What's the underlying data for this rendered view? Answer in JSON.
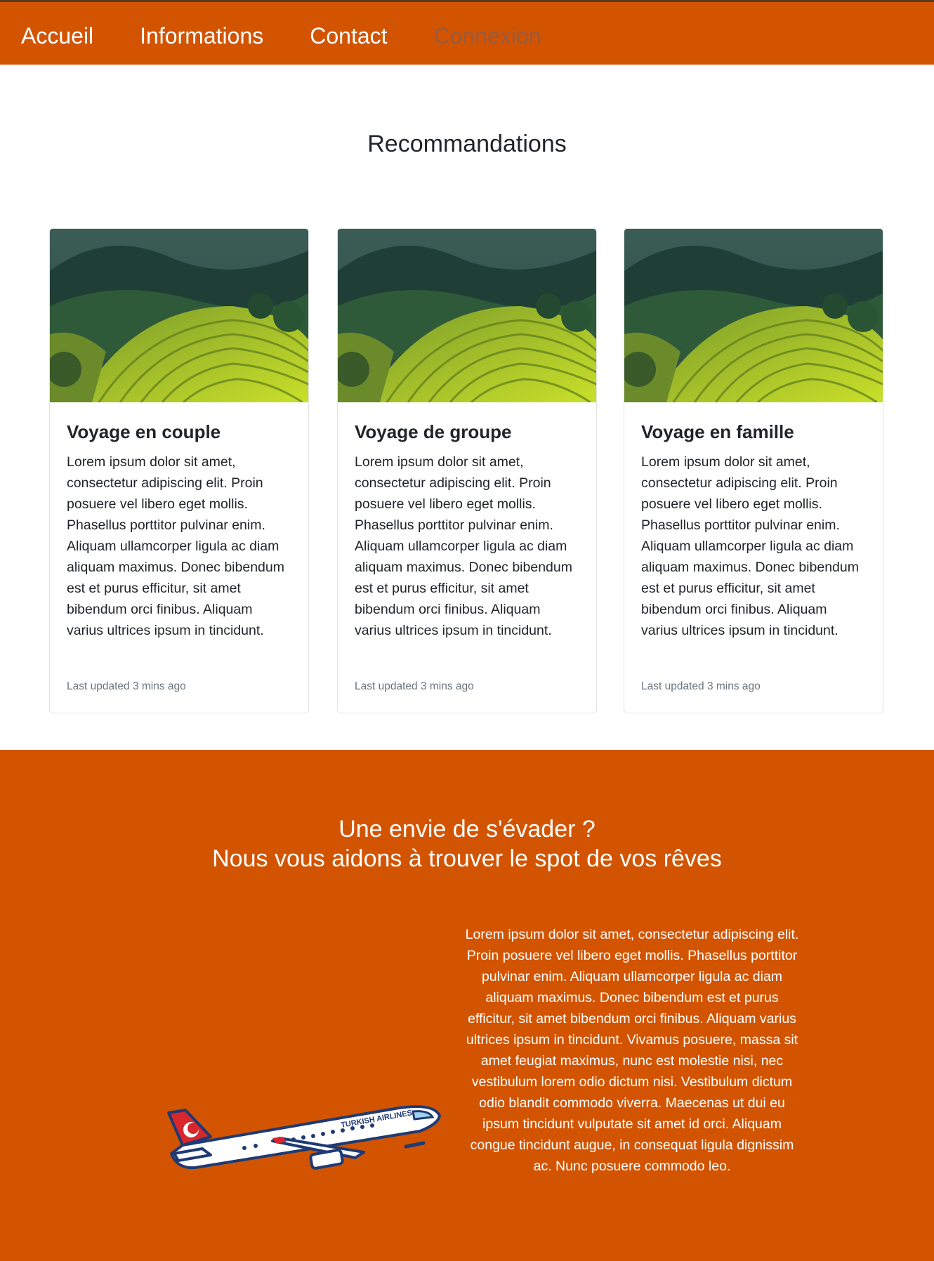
{
  "nav": {
    "items": [
      {
        "label": "Accueil"
      },
      {
        "label": "Informations"
      },
      {
        "label": "Contact"
      },
      {
        "label": "Connexion"
      }
    ]
  },
  "recommendations": {
    "title": "Recommandations",
    "cards": [
      {
        "title": "Voyage en couple",
        "text": "Lorem ipsum dolor sit amet, consectetur adipiscing elit. Proin posuere vel libero eget mollis. Phasellus porttitor pulvinar enim. Aliquam ullamcorper ligula ac diam aliquam maximus. Donec bibendum est et purus efficitur, sit amet bibendum orci finibus. Aliquam varius ultrices ipsum in tincidunt. Vivamus posuere, massa sit amet fe",
        "meta": "Last updated 3 mins ago"
      },
      {
        "title": "Voyage de groupe",
        "text": "Lorem ipsum dolor sit amet, consectetur adipiscing elit. Proin posuere vel libero eget mollis. Phasellus porttitor pulvinar enim. Aliquam ullamcorper ligula ac diam aliquam maximus. Donec bibendum est et purus efficitur, sit amet bibendum orci finibus. Aliquam varius ultrices ipsum in tincidunt. Vivamus posuere, massa sit amet fe",
        "meta": "Last updated 3 mins ago"
      },
      {
        "title": "Voyage en famille",
        "text": "Lorem ipsum dolor sit amet, consectetur adipiscing elit. Proin posuere vel libero eget mollis. Phasellus porttitor pulvinar enim. Aliquam ullamcorper ligula ac diam aliquam maximus. Donec bibendum est et purus efficitur, sit amet bibendum orci finibus. Aliquam varius ultrices ipsum in tincidunt. Vivamus posuere, massa sit amet fe",
        "meta": "Last updated 3 mins ago"
      }
    ]
  },
  "promo": {
    "title_line1": "Une envie de s'évader ?",
    "title_line2": "Nous vous aidons à trouver le spot de vos rêves",
    "text": "Lorem ipsum dolor sit amet, consectetur adipiscing elit. Proin posuere vel libero eget mollis. Phasellus porttitor pulvinar enim. Aliquam ullamcorper ligula ac diam aliquam maximus. Donec bibendum est et purus efficitur, sit amet bibendum orci finibus. Aliquam varius ultrices ipsum in tincidunt. Vivamus posuere, massa sit amet feugiat maximus, nunc est molestie nisi, nec vestibulum lorem odio dictum nisi. Vestibulum dictum odio blandit commodo viverra. Maecenas ut dui eu ipsum tincidunt vulputate sit amet id orci. Aliquam congue tincidunt augue, in consequat ligula dignissim ac. Nunc posuere commodo leo.",
    "plane_livery": "TURKISH AIRLINES"
  },
  "colors": {
    "brand_orange": "#d35400",
    "muted_link": "#9a5b3c"
  }
}
